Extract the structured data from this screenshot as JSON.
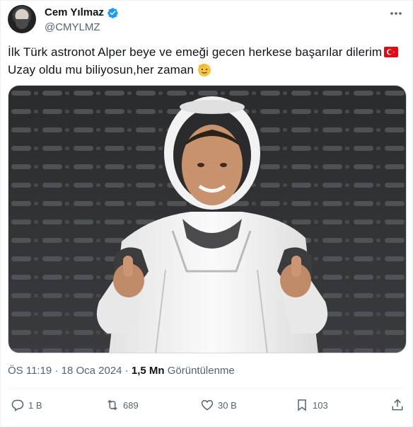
{
  "user": {
    "display_name": "Cem Yılmaz",
    "handle": "@CMYLMZ",
    "verified_icon": "verified-badge-icon",
    "accent": "#1d9bf0"
  },
  "tweet": {
    "line1": "İlk Türk astronot Alper beye  ve emeği gecen herkese başarılar dilerim",
    "line1_emoji": "turkey-flag-icon",
    "line2": "Uzay oldu mu biliyosun,her zaman",
    "line2_emoji": "saluting-face-icon"
  },
  "media": {
    "subject": "astronaut-photo"
  },
  "meta": {
    "time": "ÖS 11:19",
    "separator": "·",
    "date": "18 Oca 2024",
    "views_count": "1,5 Mn",
    "views_label": "Görüntülenme"
  },
  "actions": {
    "reply_count": "1 B",
    "retweet_count": "689",
    "like_count": "30 B",
    "bookmark_count": "103"
  }
}
